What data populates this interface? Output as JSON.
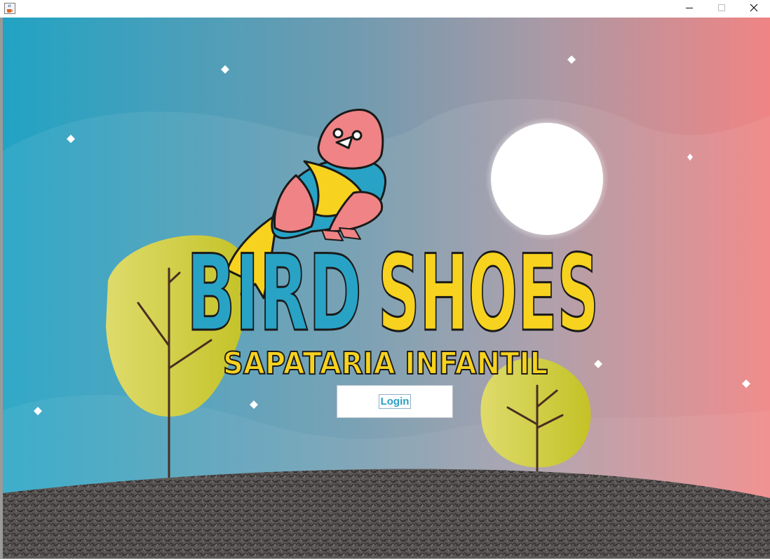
{
  "window": {
    "app_icon": "java-cup-icon",
    "controls": [
      "minimize-icon",
      "maximize-icon",
      "close-icon"
    ]
  },
  "brand": {
    "word1": "BIRD",
    "word2": "SHOES",
    "tagline": "SAPATARIA INFANTIL"
  },
  "login": {
    "label": "Login"
  },
  "colors": {
    "sky_left": "#22a3c4",
    "sky_right": "#f08484",
    "pink": "#f08385",
    "blue": "#28a3c6",
    "yellow": "#f7d21e",
    "tree": "#cfcc3c",
    "ground": "#5b5756",
    "login_text": "#2a9fc4"
  }
}
